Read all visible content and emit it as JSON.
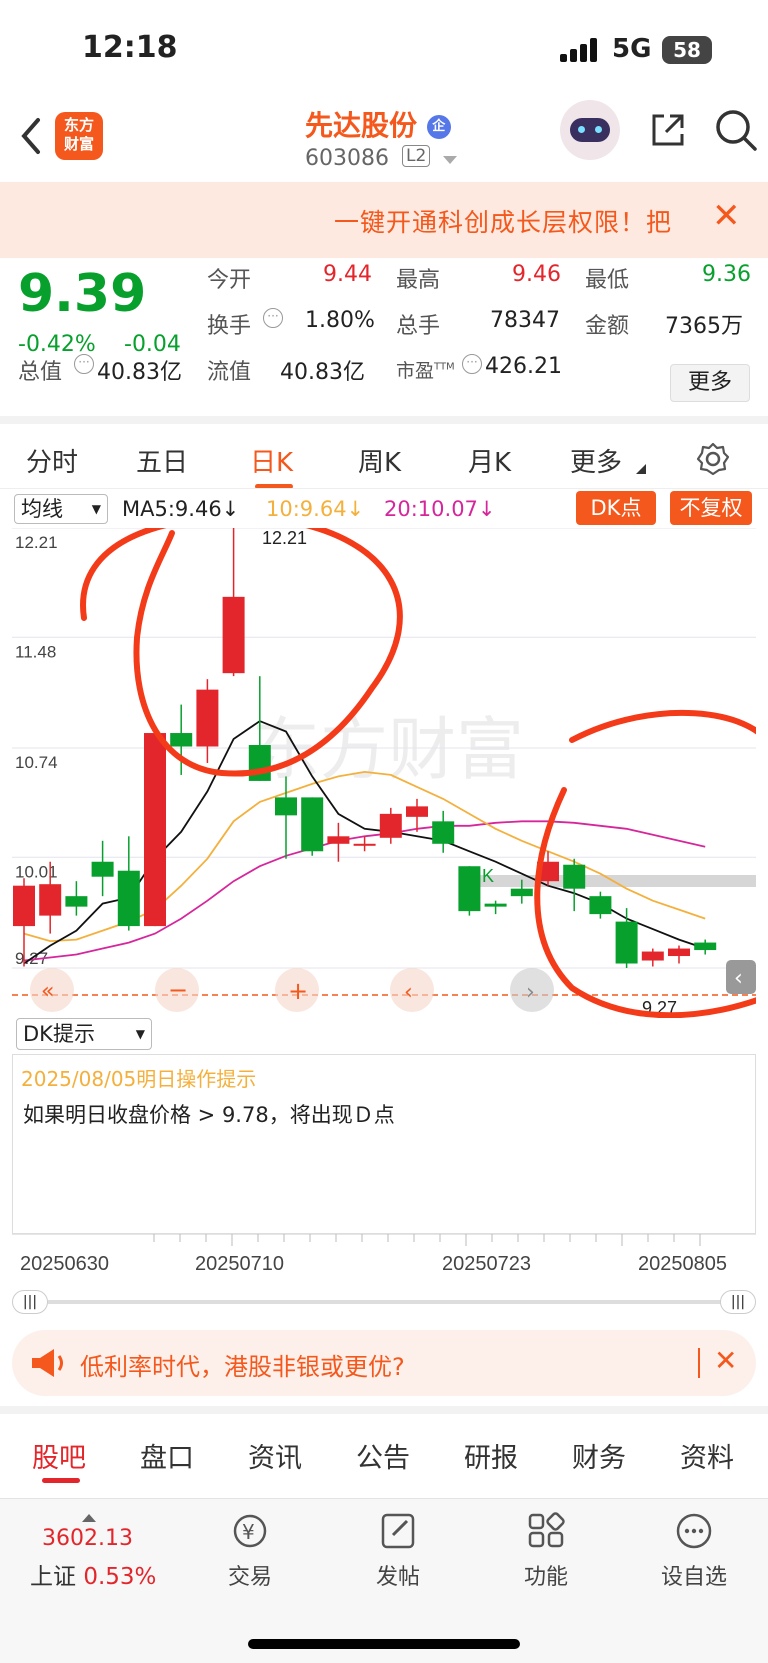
{
  "status_bar": {
    "time": "12:18",
    "network": "5G",
    "battery": "58"
  },
  "header": {
    "logo_line1": "东方",
    "logo_line2": "财富",
    "stock_name": "先达股份",
    "badge": "企",
    "stock_code": "603086",
    "level": "L2"
  },
  "banner": {
    "text": "一键开通科创成长层权限！把"
  },
  "quote": {
    "price": "9.39",
    "change_pct": "-0.42%",
    "change": "-0.04",
    "today_open_label": "今开",
    "today_open": "9.44",
    "high_label": "最高",
    "high": "9.46",
    "low_label": "最低",
    "low": "9.36",
    "turnover_label": "换手",
    "turnover": "1.80%",
    "volume_label": "总手",
    "volume": "78347",
    "amount_label": "金额",
    "amount": "7365万",
    "total_cap_label": "总值",
    "total_cap": "40.83亿",
    "float_cap_label": "流值",
    "float_cap": "40.83亿",
    "pe_label": "市盈",
    "pe_sup": "TTM",
    "pe": "426.21",
    "more_label": "更多"
  },
  "kline_tabs": [
    "分时",
    "五日",
    "日K",
    "周K",
    "月K",
    "更多"
  ],
  "chart_toolbar": {
    "indicator_select": "均线",
    "ma5": "MA5:9.46↓",
    "ma10": "10:9.64↓",
    "ma20": "20:10.07↓",
    "dk_button": "DK点",
    "adjust_button": "不复权"
  },
  "chart_data": {
    "type": "candlestick",
    "y_ticks": [
      "12.21",
      "11.48",
      "10.74",
      "10.01",
      "9.27"
    ],
    "ylim": [
      9.27,
      12.21
    ],
    "high_annotation": "12.21",
    "low_annotation": "9.27",
    "candles": [
      {
        "o": 9.55,
        "c": 9.82,
        "h": 9.87,
        "l": 9.28
      },
      {
        "o": 9.62,
        "c": 9.83,
        "h": 9.98,
        "l": 9.5
      },
      {
        "o": 9.75,
        "c": 9.68,
        "h": 9.85,
        "l": 9.62
      },
      {
        "o": 9.98,
        "c": 9.88,
        "h": 10.12,
        "l": 9.75
      },
      {
        "o": 9.92,
        "c": 9.55,
        "h": 10.15,
        "l": 9.52
      },
      {
        "o": 9.55,
        "c": 10.84,
        "h": 10.84,
        "l": 9.55
      },
      {
        "o": 10.84,
        "c": 10.75,
        "h": 11.03,
        "l": 10.56
      },
      {
        "o": 10.75,
        "c": 11.13,
        "h": 11.2,
        "l": 10.64
      },
      {
        "o": 11.24,
        "c": 11.75,
        "h": 12.21,
        "l": 11.22
      },
      {
        "o": 10.76,
        "c": 10.52,
        "h": 11.22,
        "l": 10.52
      },
      {
        "o": 10.41,
        "c": 10.29,
        "h": 10.55,
        "l": 10.0
      },
      {
        "o": 10.41,
        "c": 10.05,
        "h": 10.41,
        "l": 10.02
      },
      {
        "o": 10.1,
        "c": 10.15,
        "h": 10.24,
        "l": 9.98
      },
      {
        "o": 10.1,
        "c": 10.1,
        "h": 10.15,
        "l": 10.05
      },
      {
        "o": 10.14,
        "c": 10.3,
        "h": 10.34,
        "l": 10.1
      },
      {
        "o": 10.28,
        "c": 10.35,
        "h": 10.4,
        "l": 10.18
      },
      {
        "o": 10.25,
        "c": 10.1,
        "h": 10.32,
        "l": 10.04
      },
      {
        "o": 9.95,
        "c": 9.65,
        "h": 9.95,
        "l": 9.62
      },
      {
        "o": 9.7,
        "c": 9.68,
        "h": 9.72,
        "l": 9.63
      },
      {
        "o": 9.8,
        "c": 9.75,
        "h": 9.86,
        "l": 9.7
      },
      {
        "o": 9.85,
        "c": 9.98,
        "h": 10.05,
        "l": 9.82
      },
      {
        "o": 9.96,
        "c": 9.8,
        "h": 10.0,
        "l": 9.65
      },
      {
        "o": 9.75,
        "c": 9.63,
        "h": 9.78,
        "l": 9.6
      },
      {
        "o": 9.58,
        "c": 9.3,
        "h": 9.67,
        "l": 9.27
      },
      {
        "o": 9.32,
        "c": 9.38,
        "h": 9.4,
        "l": 9.28
      },
      {
        "o": 9.35,
        "c": 9.4,
        "h": 9.42,
        "l": 9.3
      },
      {
        "o": 9.44,
        "c": 9.39,
        "h": 9.46,
        "l": 9.36
      }
    ],
    "ma5": [
      9.3,
      9.42,
      9.52,
      9.7,
      9.74,
      10.0,
      10.18,
      10.45,
      10.8,
      10.92,
      10.85,
      10.55,
      10.3,
      10.2,
      10.18,
      10.15,
      10.12,
      10.05,
      9.98,
      9.9,
      9.82,
      9.77,
      9.7,
      9.6,
      9.53,
      9.46,
      9.4
    ],
    "ma10": [
      9.5,
      9.45,
      9.46,
      9.52,
      9.58,
      9.66,
      9.82,
      10.0,
      10.25,
      10.38,
      10.44,
      10.5,
      10.55,
      10.58,
      10.56,
      10.48,
      10.4,
      10.3,
      10.2,
      10.12,
      10.05,
      9.98,
      9.9,
      9.8,
      9.72,
      9.66,
      9.6
    ],
    "ma20": [
      9.32,
      9.34,
      9.36,
      9.4,
      9.44,
      9.5,
      9.6,
      9.72,
      9.85,
      9.95,
      10.02,
      10.07,
      10.12,
      10.15,
      10.17,
      10.2,
      10.22,
      10.22,
      10.24,
      10.25,
      10.25,
      10.24,
      10.22,
      10.2,
      10.16,
      10.12,
      10.08
    ],
    "marker_K": "K",
    "watermark": "东方财富",
    "x_labels": [
      "20250630",
      "20250710",
      "20250723",
      "20250805"
    ]
  },
  "dk_panel": {
    "select": "DK提示",
    "date_title": "2025/08/05明日操作提示",
    "message": "如果明日收盘价格 > 9.78，将出现Ｄ点"
  },
  "promo": {
    "text": "低利率时代，港股非银或更优?"
  },
  "bottom_tabs": [
    "股吧",
    "盘口",
    "资讯",
    "公告",
    "研报",
    "财务",
    "资料"
  ],
  "nav": {
    "index_value": "3602.13",
    "index_name": "上证",
    "index_pct": "0.53%",
    "trade": "交易",
    "post": "发帖",
    "functions": "功能",
    "watchlist": "设自选"
  }
}
